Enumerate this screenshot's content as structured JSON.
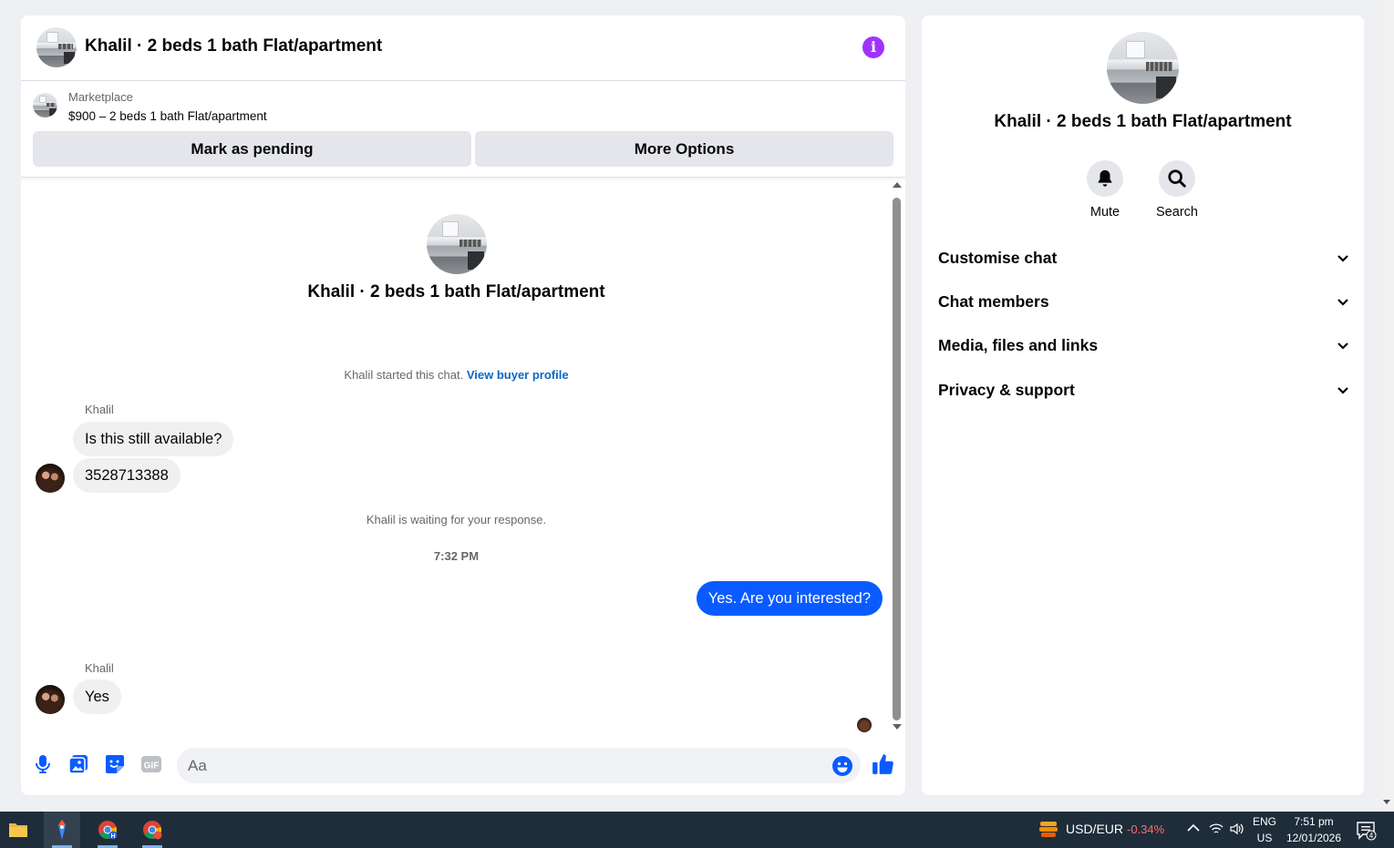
{
  "conversation": {
    "title": "Khalil · 2 beds 1 bath Flat/apartment",
    "listing_source": "Marketplace",
    "listing_price": "$900 – 2 beds 1 bath Flat/apartment",
    "mark_pending_label": "Mark as pending",
    "more_options_label": "More Options",
    "started_text": "Khalil started this chat.",
    "view_profile_label": "View buyer profile",
    "waiting_text": "Khalil is waiting for your response.",
    "timestamp": "7:32 PM",
    "messages": [
      {
        "sender": "Khalil",
        "text": "Is this still available?"
      },
      {
        "text": "3528713388"
      },
      {
        "sender": "me",
        "text": "Yes. Are you interested?"
      },
      {
        "sender": "Khalil",
        "text": "Yes"
      }
    ]
  },
  "composer": {
    "placeholder": "Aa",
    "icons": [
      "microphone-icon",
      "photo-icon",
      "sticker-icon",
      "gif-icon",
      "emoji-icon",
      "thumbs-up-icon"
    ],
    "gif_label": "GIF"
  },
  "info_panel": {
    "title": "Khalil · 2 beds 1 bath Flat/apartment",
    "actions": [
      {
        "label": "Mute",
        "icon": "bell-icon"
      },
      {
        "label": "Search",
        "icon": "search-icon"
      }
    ],
    "sections": [
      {
        "label": "Customise chat"
      },
      {
        "label": "Chat members"
      },
      {
        "label": "Media, files and links"
      },
      {
        "label": "Privacy & support"
      }
    ]
  },
  "taskbar": {
    "apps": [
      "file-explorer-icon",
      "app-icon",
      "chrome-icon",
      "chrome-icon"
    ],
    "ticker_name": "USD/EUR",
    "ticker_change": "-0.34%",
    "language": "ENG",
    "region": "US",
    "time": "7:51 pm",
    "date": "12/01/2026",
    "notification_count": "4"
  },
  "colors": {
    "accent_blue": "#0a5bff",
    "link_blue": "#0a66c2",
    "info_purple": "#a033ff",
    "negative_red": "#ff6b6b"
  }
}
